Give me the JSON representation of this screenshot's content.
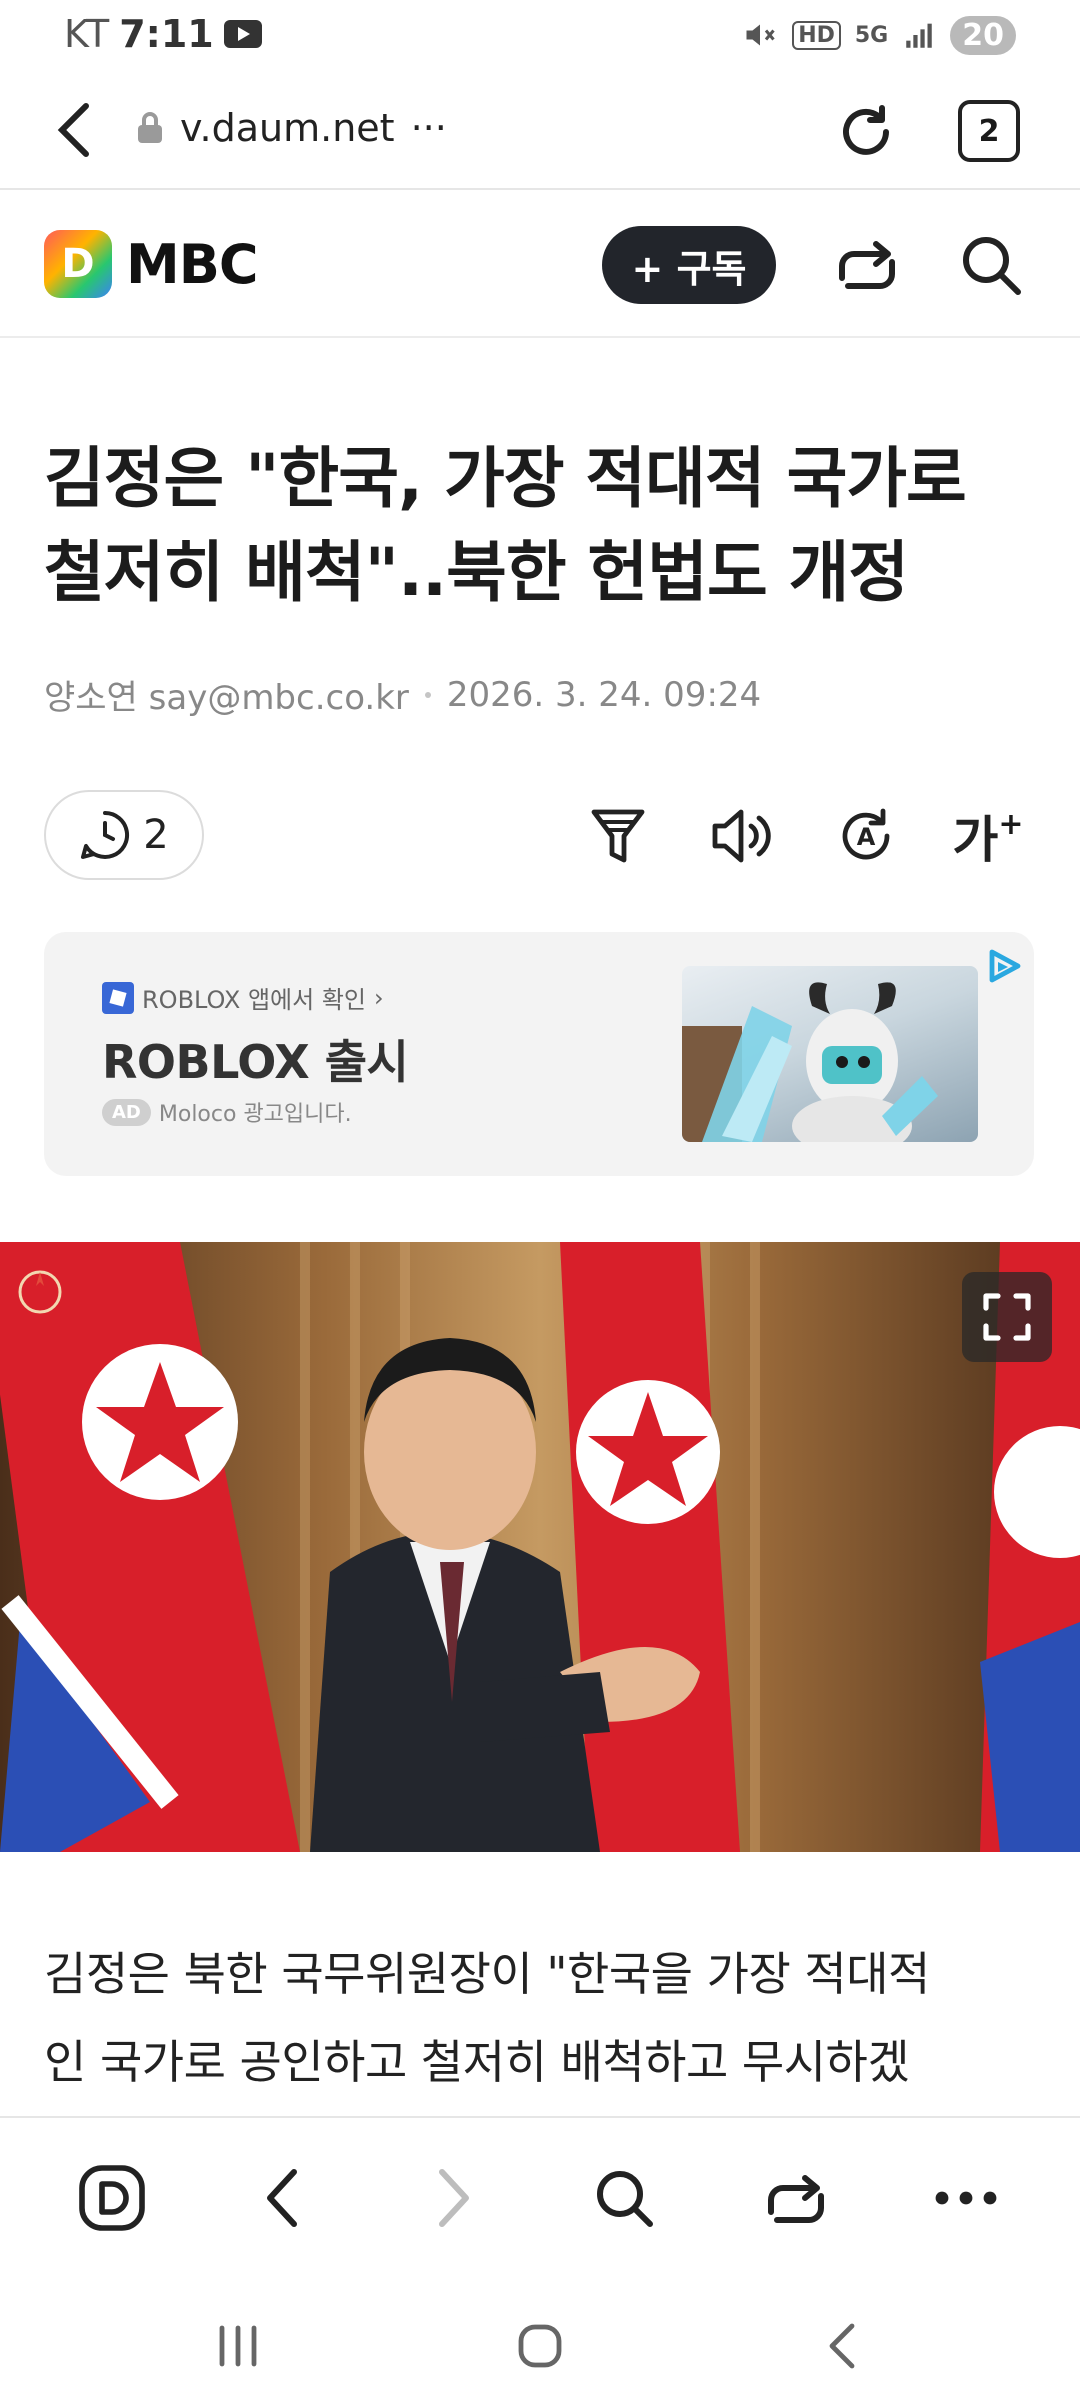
{
  "status_bar": {
    "carrier": "KT",
    "time": "7:11",
    "network": "5G",
    "hd": "HD",
    "battery": "20"
  },
  "browser": {
    "url": "v.daum.net",
    "more": "···",
    "tab_count": "2"
  },
  "site": {
    "brand_letter": "D",
    "brand_name": "MBC",
    "subscribe_label": "+ 구독"
  },
  "article": {
    "headline_line1": "김정은 \"한국, 가장 적대적 국가로",
    "headline_line2": "철저히 배척\"..북한 헌법도 개정",
    "author": "양소연 say@mbc.co.kr",
    "date": "2026. 3. 24. 09:24",
    "comment_count": "2",
    "font_size_tool": "가",
    "body_line1": "김정은 북한 국무위원장이 \"한국을 가장 적대적",
    "body_line2": "인 국가로 공인하고 철저히 배척하고 무시하겠"
  },
  "ad": {
    "source_label": "ROBLOX 앱에서 확인",
    "title": "ROBLOX 출시",
    "badge": "AD",
    "disclaimer": "Moloco 광고입니다."
  },
  "colors": {
    "accent_dark": "#22252b",
    "text": "#1c1c1c",
    "muted": "#888888",
    "ad_bg": "#f3f3f3"
  }
}
